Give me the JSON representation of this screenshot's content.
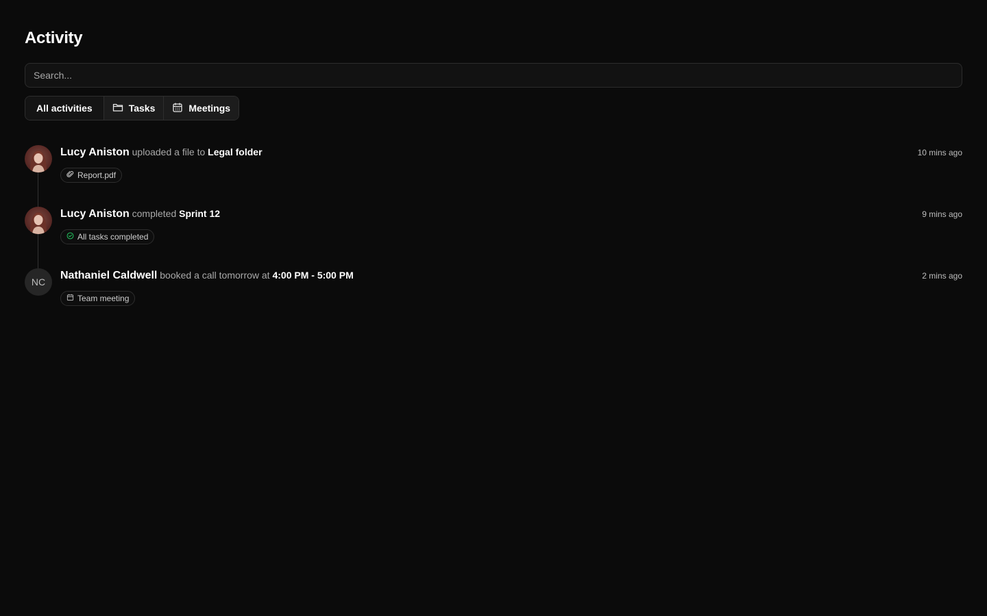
{
  "header": {
    "title": "Activity"
  },
  "search": {
    "placeholder": "Search..."
  },
  "filters": [
    {
      "label": "All activities",
      "icon": ""
    },
    {
      "label": "Tasks",
      "icon": "folder-icon"
    },
    {
      "label": "Meetings",
      "icon": "calendar-icon"
    }
  ],
  "activities": [
    {
      "user": "Lucy Aniston",
      "action": "uploaded a file to",
      "target": "Legal folder",
      "time": "10 mins ago",
      "chip": {
        "label": "Report.pdf",
        "icon": "paperclip-icon"
      }
    },
    {
      "user": "Lucy Aniston",
      "action": "completed",
      "target": "Sprint 12",
      "time": "9 mins ago",
      "chip": {
        "label": "All tasks completed",
        "icon": "check-circle-icon",
        "icon_color": "#22c55e"
      }
    },
    {
      "user": "Nathaniel Caldwell",
      "initials": "NC",
      "action": "booked a call tomorrow at",
      "target": "4:00 PM - 5:00 PM",
      "time": "2 mins ago",
      "chip": {
        "label": "Team meeting",
        "icon": "calendar-icon"
      }
    }
  ]
}
